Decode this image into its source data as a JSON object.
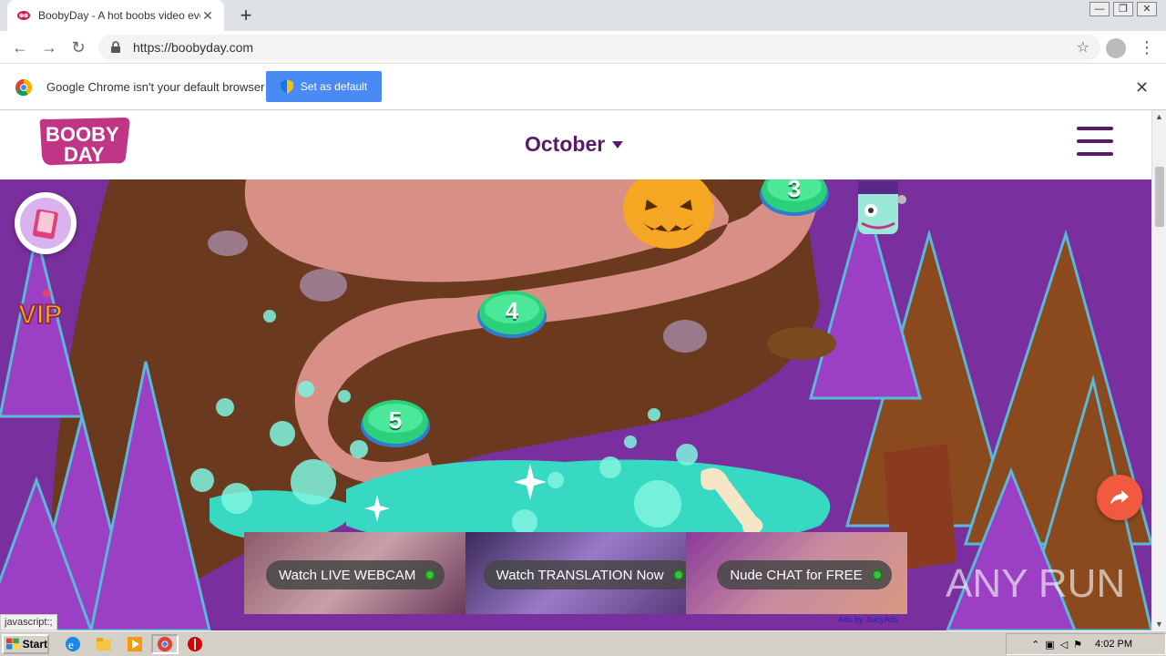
{
  "browser": {
    "tab_title": "BoobyDay - A hot boobs video every",
    "tab_close": "✕",
    "new_tab": "+",
    "url": "https://boobyday.com",
    "back": "←",
    "forward": "→",
    "reload": "↻",
    "star": "☆",
    "menu": "⋮",
    "window_controls": [
      "—",
      "❐",
      "✕"
    ]
  },
  "infobar": {
    "message": "Google Chrome isn't your default browser",
    "button_label": "Set as default",
    "close": "✕"
  },
  "site": {
    "logo_text_top": "BOOBY",
    "logo_text_bottom": "DAY",
    "month_label": "October",
    "vip_label": "VIP"
  },
  "levels": [
    {
      "label": "3"
    },
    {
      "label": "4"
    },
    {
      "label": "5"
    }
  ],
  "ads": {
    "items": [
      {
        "label": "Watch LIVE WEBCAM"
      },
      {
        "label": "Watch TRANSLATION Now"
      },
      {
        "label": "Nude CHAT for FREE"
      }
    ],
    "ads_by": "Ads by JuicyAds"
  },
  "watermark": "ANY RUN",
  "status_text": "javascript:;",
  "taskbar": {
    "start_label": "Start",
    "clock": "4:02 PM"
  },
  "colors": {
    "brand_purple": "#5a1a6a",
    "chrome_blue": "#4a8af4",
    "share_orange": "#f15a3f",
    "level_green": "#2bd07a"
  }
}
